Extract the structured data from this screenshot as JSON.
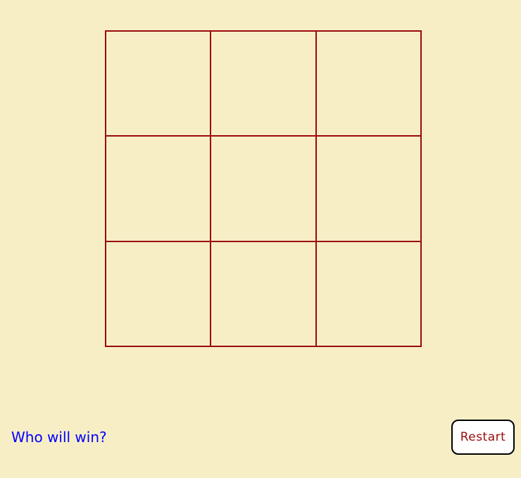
{
  "board": {
    "cells": [
      "",
      "",
      "",
      "",
      "",
      "",
      "",
      "",
      ""
    ]
  },
  "status": {
    "text": "Who will win?"
  },
  "controls": {
    "restart_label": "Restart"
  },
  "colors": {
    "background": "#F7EEC6",
    "grid_line": "#9A0A0A",
    "status_text": "#0000FF",
    "button_text": "#9A0A0A"
  }
}
